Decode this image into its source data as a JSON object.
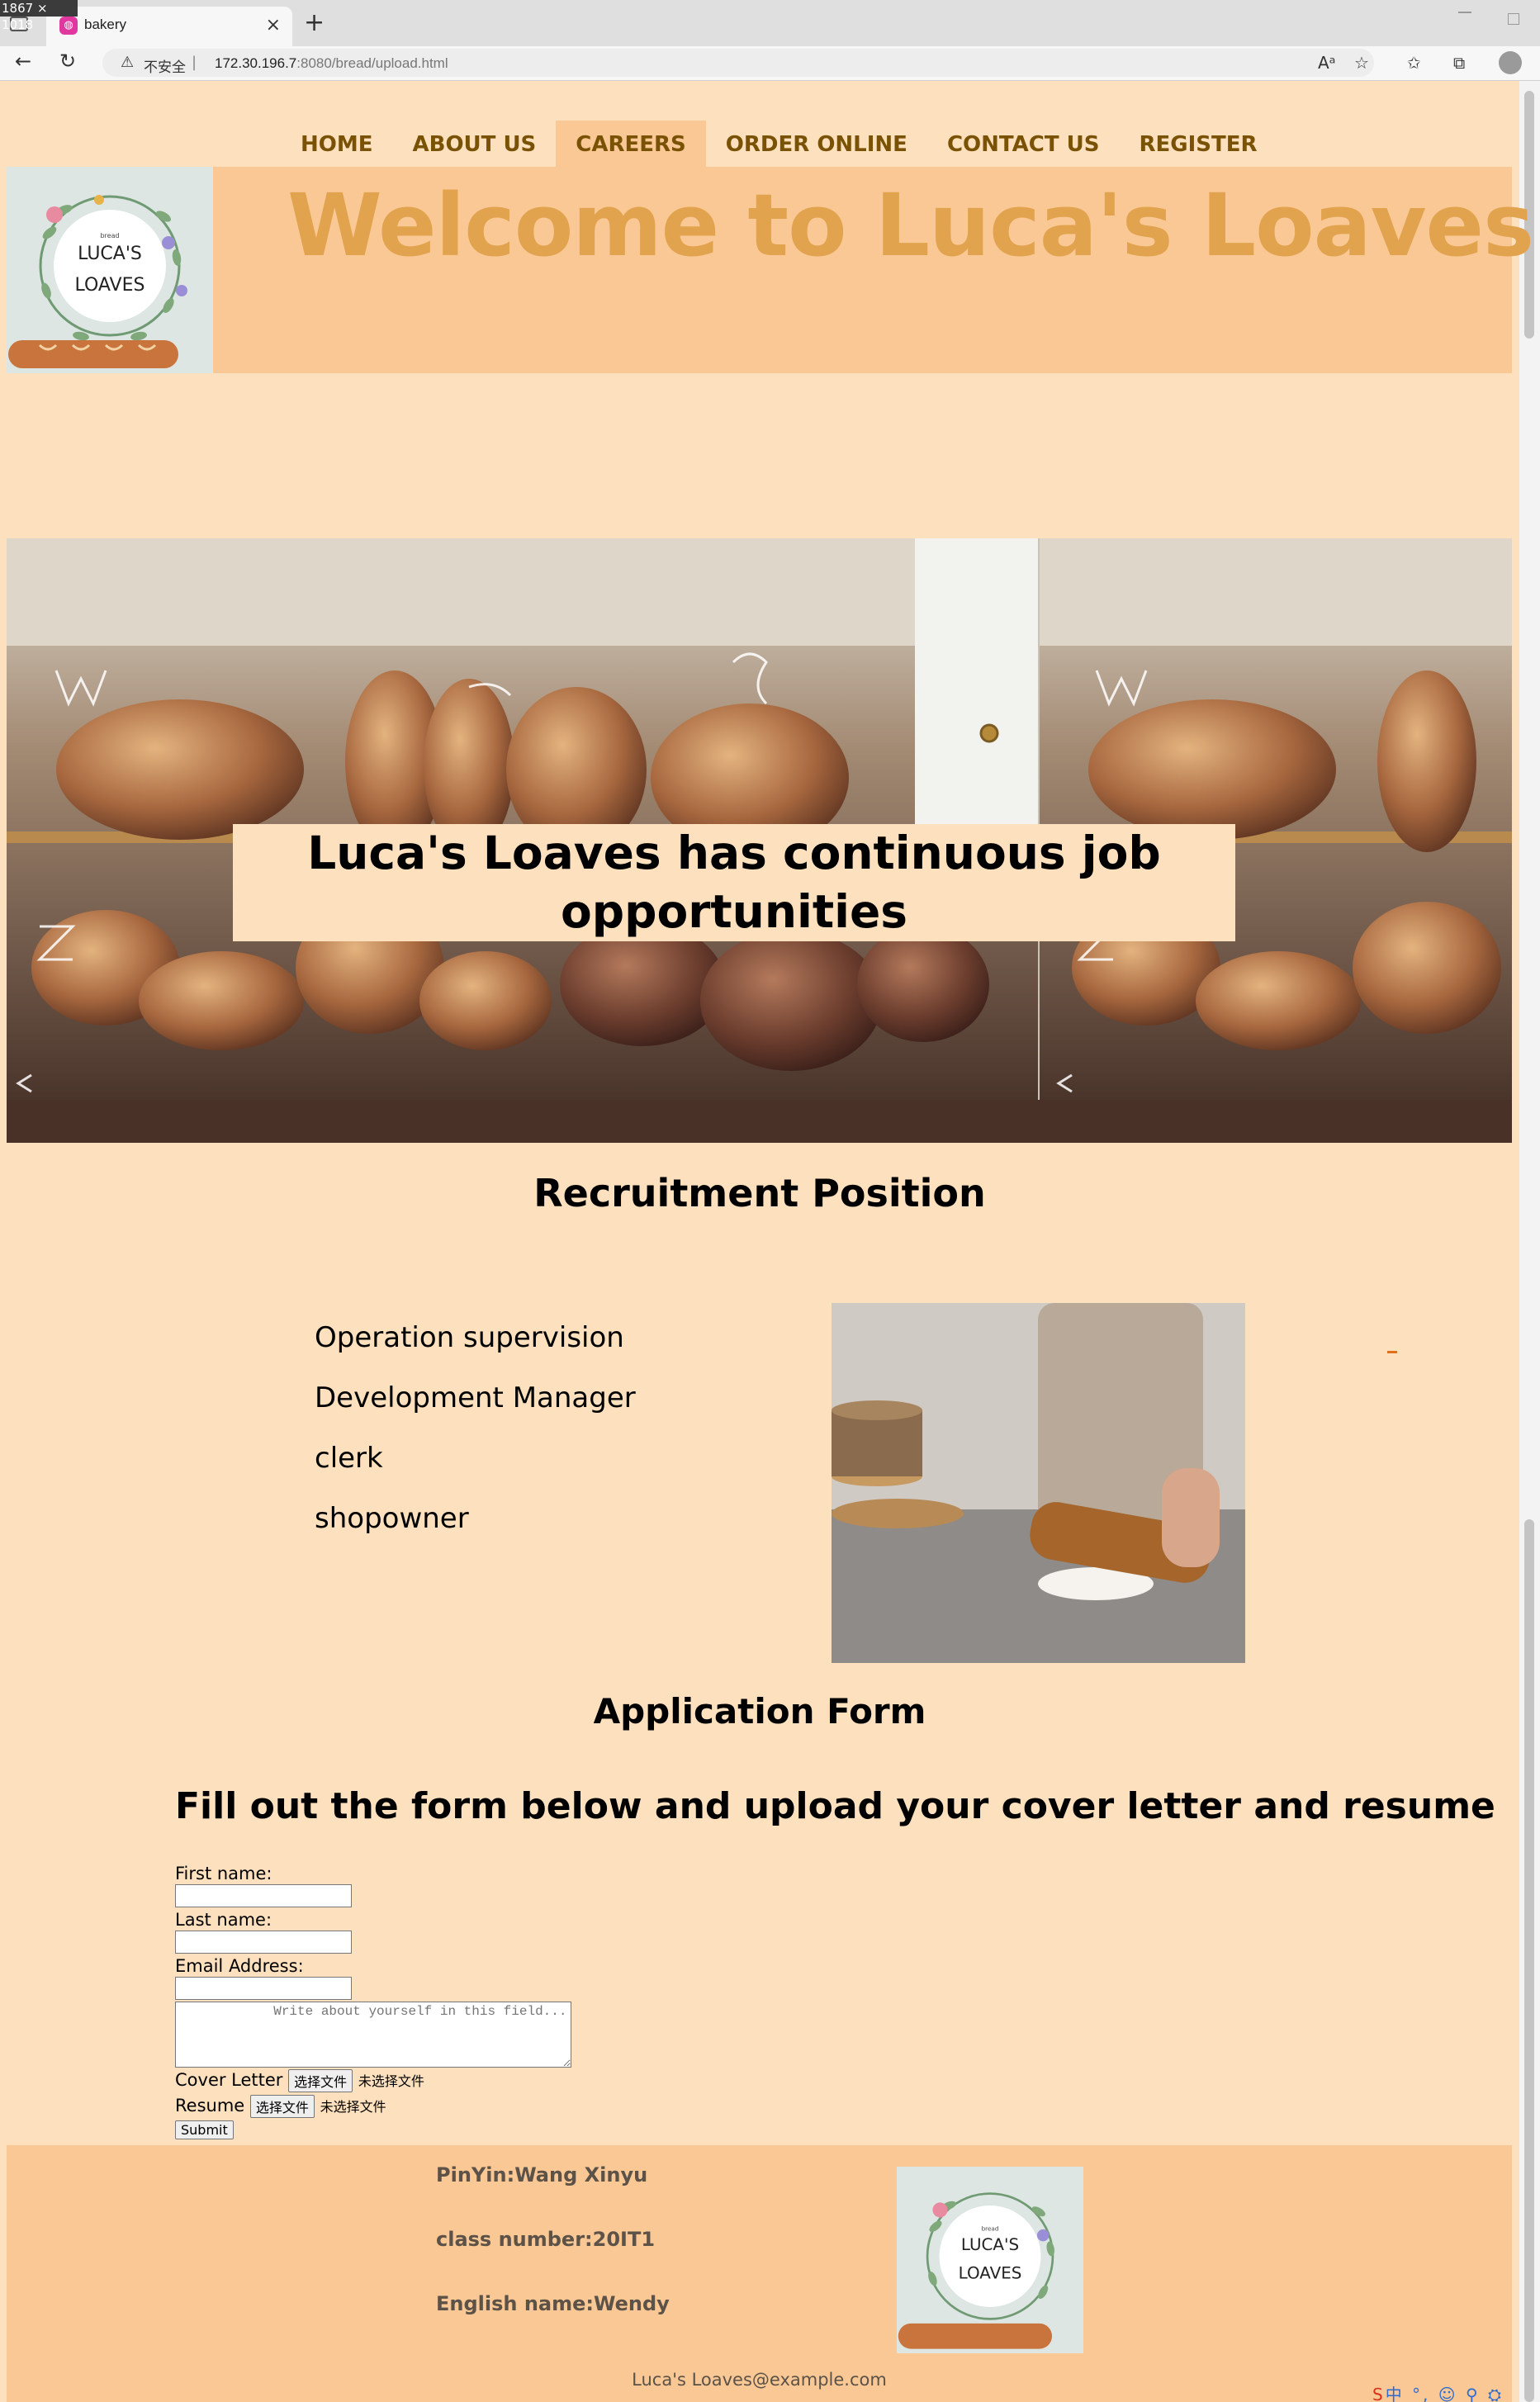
{
  "screen_size_label": "1867 × 1018",
  "browser": {
    "tab_title": "bakery",
    "insecure_label": "不安全",
    "url_host": "172.30.196.7",
    "url_rest": ":8080/bread/upload.html",
    "icons": [
      "sidebar-icon",
      "close-icon",
      "plus-icon",
      "back-icon",
      "reload-icon",
      "warning-icon",
      "read-aloud-icon",
      "favorite-add-icon",
      "favorites-icon",
      "collections-icon",
      "profile-icon"
    ]
  },
  "nav": {
    "items": [
      {
        "label": "HOME"
      },
      {
        "label": "ABOUT US"
      },
      {
        "label": "CAREERS",
        "active": true
      },
      {
        "label": "ORDER ONLINE"
      },
      {
        "label": "CONTACT US"
      },
      {
        "label": "REGISTER"
      }
    ]
  },
  "header": {
    "logo_text_small": "bread",
    "logo_line1": "LUCA'S",
    "logo_line2": "LOAVES",
    "welcome": "Welcome to Luca's Loaves"
  },
  "banner": {
    "caption_line1": "Luca's Loaves has continuous job",
    "caption_line2": "opportunities"
  },
  "recruitment": {
    "heading": "Recruitment Position",
    "positions": [
      "Operation supervision",
      "Development Manager",
      "clerk",
      "shopowner"
    ]
  },
  "application": {
    "heading": "Application Form",
    "subheading": "Fill out the form below and upload your cover letter and resume",
    "first_name_label": "First name:",
    "last_name_label": "Last name:",
    "email_label": "Email Address:",
    "about_placeholder": "            Write about yourself in this field...",
    "cover_letter_label": "Cover Letter",
    "resume_label": "Resume",
    "choose_file_label": "选择文件",
    "no_file_label": "未选择文件",
    "submit_label": "Submit"
  },
  "footer": {
    "pinyin": "PinYin:Wang Xinyu",
    "class_number": "class number:20IT1",
    "english_name": "English name:Wendy",
    "email": "Luca's Loaves@example.com"
  },
  "colors": {
    "page_bg": "#fde0bd",
    "header_bg": "#f9c894",
    "welcome_text": "#e2a34e",
    "nav_text": "#7a5205"
  }
}
